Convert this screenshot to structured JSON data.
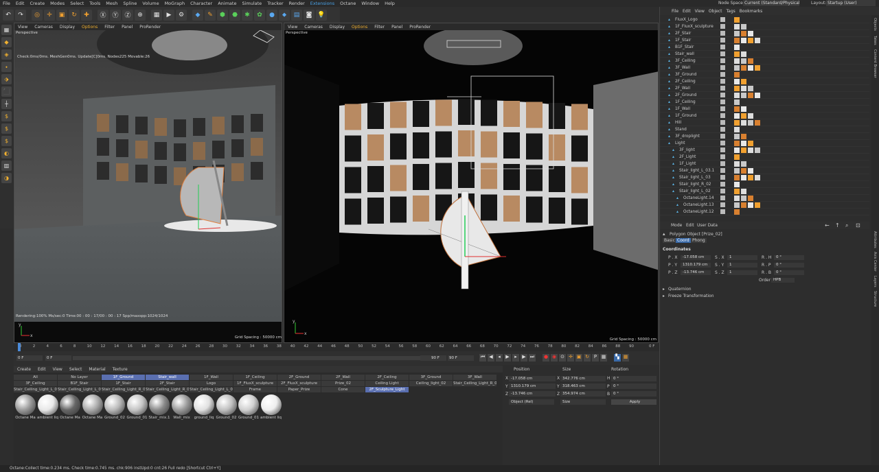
{
  "menubar": {
    "items": [
      "File",
      "Edit",
      "Create",
      "Modes",
      "Select",
      "Tools",
      "Mesh",
      "Spline",
      "Volume",
      "MoGraph",
      "Character",
      "Animate",
      "Simulate",
      "Tracker",
      "Render",
      "Extensions",
      "Octane",
      "Window",
      "Help"
    ],
    "node_space_label": "Node Space:",
    "node_space_value": "Current (Standard/Physical)",
    "layout_label": "Layout:",
    "layout_value": "Startup (User)"
  },
  "viewport_left": {
    "menu": [
      "View",
      "Cameras",
      "Display",
      "Options",
      "Filter",
      "Panel",
      "ProRender"
    ],
    "label": "Perspective",
    "info": "Check:0ms/0ms. MeshGen0ms. Update[C]0ms. Nodes225 Movable:26",
    "render_info": "Rendering:100% Ms/sec:0 Time:00 : 00 : 17/00 : 00 : 17 Spp/maxspp:1024/1024",
    "grid": "Grid Spacing : 50000 cm"
  },
  "viewport_right": {
    "menu": [
      "View",
      "Cameras",
      "Display",
      "Options",
      "Filter",
      "Panel",
      "ProRender"
    ],
    "label": "Perspective",
    "grid": "Grid Spacing : 50000 cm"
  },
  "timeline": {
    "ticks": [
      "0",
      "2",
      "4",
      "6",
      "8",
      "10",
      "12",
      "14",
      "16",
      "18",
      "20",
      "22",
      "24",
      "26",
      "28",
      "30",
      "32",
      "34",
      "36",
      "38",
      "40",
      "42",
      "44",
      "46",
      "48",
      "50",
      "52",
      "54",
      "56",
      "58",
      "60",
      "62",
      "64",
      "66",
      "68",
      "70",
      "72",
      "74",
      "76",
      "78",
      "80",
      "82",
      "84",
      "86",
      "88",
      "90"
    ],
    "end_label": "0 F",
    "start_field": "0 F",
    "start_field2": "0 F",
    "end_field": "90 F",
    "end_field2": "90 F"
  },
  "material_manager": {
    "menu": [
      "Create",
      "Edit",
      "View",
      "Select",
      "Material",
      "Texture"
    ],
    "layers_row1": [
      "All",
      "No Layer",
      "1F_Ground",
      "Stair_wall",
      "1F_Wall",
      "1F_Ceiling",
      "2F_Ground",
      "2F_Wall",
      "2F_Ceiling",
      "3F_Ground",
      "3F_Wall"
    ],
    "layers_row2": [
      "3F_Ceiling",
      "B1F_Stair",
      "1F_Stair",
      "2F_Stair",
      "Logo",
      "1F_FluxX_sculpture",
      "2F_FluxX_sculpture",
      "Prize_02",
      "Ceiling Light",
      "Ceiling_light_02",
      "Stair_Ceiling_Light_R_01"
    ],
    "layers_row3": [
      "Stair_Ceiling_Light_L_01",
      "Stair_Ceiling_Light_L_02",
      "Stair_Ceiling_Light_R_02",
      "Stair_Ceiling_Light_R_03",
      "Stair_Ceiling_Light_L_03",
      "Frame",
      "Paper_Prize",
      "Cone",
      "2F_Sculpture_Light"
    ],
    "materials": [
      "Octane Ma",
      "ambient liq",
      "Octane Ma",
      "Octane Ma",
      "Ground_02",
      "Ground_01",
      "Stair_mix.1",
      "Wall_mix",
      "ground_liq",
      "Ground_02",
      "Ground_01",
      "ambient liq"
    ]
  },
  "coord_manager": {
    "headers": [
      "Position",
      "Size",
      "Rotation"
    ],
    "x_pos": "-17.058 cm",
    "y_pos": "1310.179 cm",
    "z_pos": "-13.746 cm",
    "x_size": "342.776 cm",
    "y_size": "318.463 cm",
    "z_size": "354.974 cm",
    "h_rot": "0 °",
    "p_rot": "0 °",
    "b_rot": "0 °",
    "mode": "Object (Rel)",
    "size_mode": "Size",
    "apply": "Apply"
  },
  "object_manager": {
    "menu": [
      "File",
      "Edit",
      "View",
      "Object",
      "Tags",
      "Bookmarks"
    ],
    "objects": [
      "FluxX_Logo",
      "1F_FluxX_sculpture",
      "2F_Stair",
      "1F_Stair",
      "B1F_Stair",
      "Stair_wall",
      "3F_Ceiling",
      "3F_Wall",
      "3F_Ground",
      "2F_Ceiling",
      "2F_Wall",
      "2F_Ground",
      "1F_Ceiling",
      "1F_Wall",
      "1F_Ground",
      "Hill",
      "Stand",
      "3F_droplight",
      "Light",
      "3F_light",
      "2F_Light",
      "1F_Light",
      "Stair_light_L_03.1",
      "Stair_light_L_03",
      "Stair_light_R_02",
      "Stair_light_L_02",
      "OctaneLight.14",
      "OctaneLight.13",
      "OctaneLight.12"
    ]
  },
  "attributes": {
    "menu": [
      "Mode",
      "Edit",
      "User Data"
    ],
    "title": "Polygon Object [Prize_02]",
    "tabs": [
      "Basic",
      "Coord",
      "Phong"
    ],
    "section": "Coordinates",
    "px": "-17.058 cm",
    "py": "1310.179 cm",
    "pz": "-13.746 cm",
    "sx": "1",
    "sy": "1",
    "sz": "1",
    "rh": "0 °",
    "rp": "0 °",
    "rb": "0 °",
    "order_label": "Order",
    "order": "HPB",
    "quaternion": "Quaternion",
    "freeze": "Freeze Transformation"
  },
  "side_tabs": [
    "Objects",
    "Takes",
    "Content Browser",
    "Attributes",
    "Axis Center",
    "Layers",
    "Structure"
  ],
  "status": "Octane:Collect time:0.234 ms.  Check time:0.745 ms.  chk:906  instUpd:0  cnt:26        Full redo [Shortcut Ctrl+Y]",
  "colors": {
    "accent": "#4aa3e8",
    "orange": "#f0a030",
    "selected_layer": "#5a6fb0"
  }
}
